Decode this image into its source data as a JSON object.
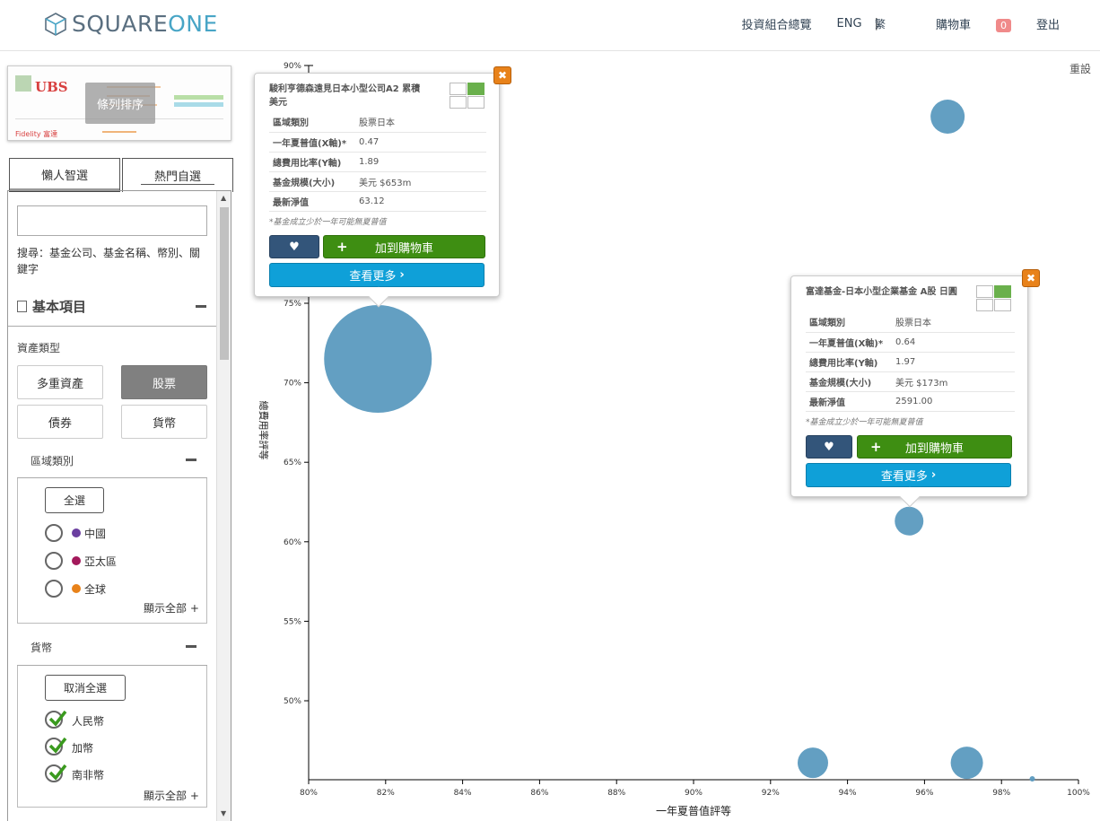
{
  "header": {
    "logo_a": "SQUARE",
    "logo_b": "ONE",
    "nav_portfolio": "投資組合總覽",
    "nav_eng": "ENG",
    "nav_trad": "繁",
    "nav_cart": "購物車",
    "cart_count": "0",
    "nav_logout": "登出"
  },
  "thumbnail": {
    "sort_label": "條列排序",
    "ubs": "UBS",
    "fidelity": "Fidelity 富達"
  },
  "tabs": {
    "tab1": "懶人智選",
    "tab2": "熱門自選"
  },
  "filters": {
    "search_value": "",
    "search_hint": "搜尋：基金公司、基金名稱、幣別、關鍵字",
    "section_title": "基本項目",
    "asset_type_label": "資產類型",
    "assets": [
      "多重資產",
      "股票",
      "債券",
      "貨幣"
    ],
    "active_asset": "股票",
    "region_label": "區域類別",
    "select_all": "全選",
    "regions": [
      {
        "name": "中國",
        "color": "#6b3fa0"
      },
      {
        "name": "亞太區",
        "color": "#a3195b"
      },
      {
        "name": "全球",
        "color": "#e8821a"
      }
    ],
    "show_all": "顯示全部 +",
    "currency_label": "貨幣",
    "deselect_all": "取消全選",
    "currencies": [
      "人民幣",
      "加幣",
      "南非幣"
    ]
  },
  "chart_data": {
    "type": "scatter",
    "xlabel": "一年夏普值評等",
    "ylabel": "總費用率評等",
    "xlim": [
      80,
      100
    ],
    "ylim": [
      45,
      90
    ],
    "x_ticks": [
      "80%",
      "82%",
      "84%",
      "86%",
      "88%",
      "90%",
      "92%",
      "94%",
      "96%",
      "98%",
      "100%"
    ],
    "y_ticks": [
      "50%",
      "55%",
      "60%",
      "65%",
      "70%",
      "75%",
      "90%"
    ],
    "points": [
      {
        "x": 81.8,
        "y": 71.5,
        "size": 60
      },
      {
        "x": 96.6,
        "y": 87.2,
        "size": 19
      },
      {
        "x": 95.6,
        "y": 61.3,
        "size": 16
      },
      {
        "x": 93.1,
        "y": 46.1,
        "size": 17
      },
      {
        "x": 97.1,
        "y": 46.1,
        "size": 18
      },
      {
        "x": 98.8,
        "y": 45.0,
        "size": 3
      }
    ],
    "bubble_color": "#5b9abf",
    "reset": "重設"
  },
  "tooltip1": {
    "title": "駿利亨德森遠見日本小型公司A2 累積 美元",
    "rows": [
      [
        "區域類別",
        "股票日本"
      ],
      [
        "一年夏普值(X軸)*",
        "0.47"
      ],
      [
        "總費用比率(Y軸)",
        "1.89"
      ],
      [
        "基金規模(大小)",
        "美元 $653m"
      ],
      [
        "最新淨值",
        "63.12"
      ]
    ],
    "note": "*基金成立少於一年可能無夏普值",
    "cart": "加到購物車",
    "more": "查看更多"
  },
  "tooltip2": {
    "title": "富達基金-日本小型企業基金 A股 日圓",
    "rows": [
      [
        "區域類別",
        "股票日本"
      ],
      [
        "一年夏普值(X軸)*",
        "0.64"
      ],
      [
        "總費用比率(Y軸)",
        "1.97"
      ],
      [
        "基金規模(大小)",
        "美元 $173m"
      ],
      [
        "最新淨值",
        "2591.00"
      ]
    ],
    "note": "*基金成立少於一年可能無夏普值",
    "cart": "加到購物車",
    "more": "查看更多"
  }
}
